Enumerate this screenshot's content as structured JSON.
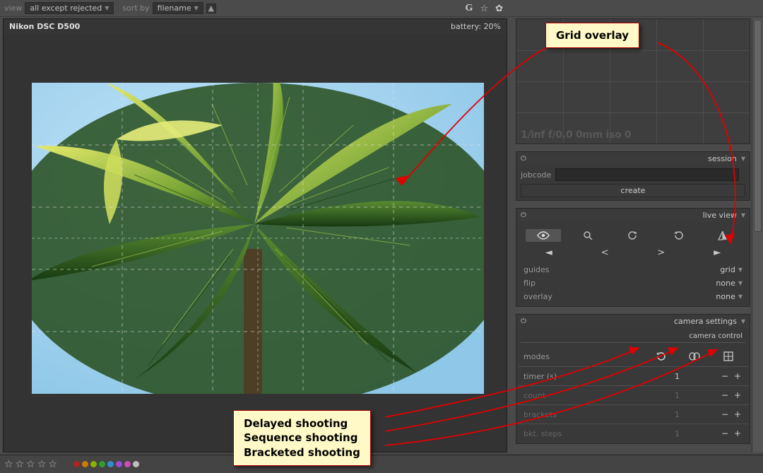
{
  "topbar": {
    "view_label": "view",
    "view_value": "all except rejected",
    "sort_label": "sort by",
    "sort_value": "filename",
    "icons": {
      "g": "G",
      "star": "☆",
      "gear": "⚙"
    }
  },
  "camera": {
    "model": "Nikon DSC D500",
    "battery": "battery: 20%"
  },
  "preview": {
    "meta": "1/inf f/0.0 0mm iso 0"
  },
  "session": {
    "title": "session",
    "jobcode_label": "jobcode",
    "jobcode_value": "",
    "create_label": "create"
  },
  "liveview": {
    "title": "live view",
    "guides_label": "guides",
    "guides_value": "grid",
    "flip_label": "flip",
    "flip_value": "none",
    "overlay_label": "overlay",
    "overlay_value": "none",
    "icons": {
      "eye": "eye-icon",
      "mag": "search-icon",
      "rotccw": "rotate-ccw-icon",
      "rotcw": "rotate-cw-icon",
      "mirror": "mirror-icon",
      "left": "play-left-icon",
      "lt": "less-than-icon",
      "gt": "greater-than-icon",
      "right": "play-right-icon"
    }
  },
  "camsettings": {
    "title": "camera settings",
    "tab": "camera control",
    "modes_label": "modes",
    "timer_label": "timer (s)",
    "timer_value": "1",
    "count_label": "count",
    "count_value": "1",
    "brackets_label": "brackets",
    "brackets_value": "1",
    "bkt_label": "bkt. steps",
    "bkt_value": "1",
    "plus": "+",
    "minus": "−"
  },
  "annotations": {
    "grid_overlay": "Grid overlay",
    "delayed": "Delayed shooting",
    "sequence": "Sequence shooting",
    "bracketed": "Bracketed shooting"
  },
  "dots": [
    "#b22222",
    "#cc7a00",
    "#8ab300",
    "#2e9e2e",
    "#2e8fcc",
    "#9a4dcc",
    "#cc4db3",
    "#bfbfbf"
  ]
}
